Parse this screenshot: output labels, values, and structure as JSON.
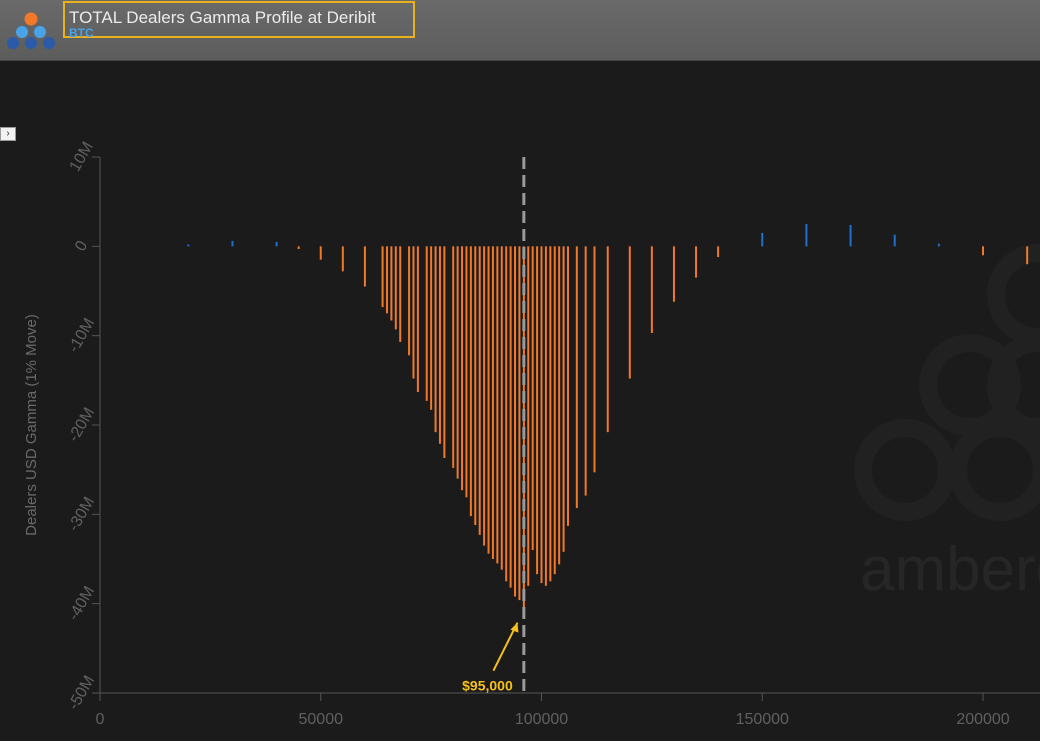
{
  "header": {
    "title": "TOTAL Dealers Gamma Profile at Deribit",
    "subtitle": "BTC",
    "logo_icon": "amberdata-logo-icon",
    "expand_icon": "chevron-right-icon"
  },
  "colors": {
    "negative": "#f2782a",
    "positive": "#1f6fd1",
    "annotation": "#f5c01c",
    "spot_line": "#9a9a9a"
  },
  "chart_data": {
    "type": "bar",
    "title": "TOTAL Dealers Gamma Profile at Deribit",
    "subtitle": "BTC",
    "xlabel": "",
    "ylabel": "Dealers USD Gamma (1% Move)",
    "xlim": [
      0,
      212000
    ],
    "ylim": [
      -50000000,
      10000000
    ],
    "x_ticks": [
      0,
      50000,
      100000,
      150000,
      200000
    ],
    "x_tick_labels": [
      "0",
      "50000",
      "100000",
      "150000",
      "200000"
    ],
    "y_ticks": [
      10000000,
      0,
      -10000000,
      -20000000,
      -30000000,
      -40000000,
      -50000000
    ],
    "y_tick_labels": [
      "10M",
      "0",
      "-10M",
      "-20M",
      "-30M",
      "-40M",
      "-50M"
    ],
    "spot_price": 96000,
    "annotation": {
      "text": "$95,000",
      "x": 95000,
      "y": -40000000
    },
    "grid": false,
    "watermark": "amberdata",
    "strikes": [
      20000,
      30000,
      40000,
      45000,
      50000,
      55000,
      60000,
      64000,
      65000,
      66000,
      67000,
      68000,
      70000,
      71000,
      72000,
      74000,
      75000,
      76000,
      77000,
      78000,
      80000,
      81000,
      82000,
      83000,
      84000,
      85000,
      86000,
      87000,
      88000,
      89000,
      90000,
      91000,
      92000,
      93000,
      94000,
      95000,
      96000,
      97000,
      98000,
      99000,
      100000,
      101000,
      102000,
      103000,
      104000,
      105000,
      106000,
      108000,
      110000,
      112000,
      115000,
      120000,
      125000,
      130000,
      135000,
      140000,
      150000,
      160000,
      170000,
      180000,
      190000,
      200000,
      210000
    ],
    "gamma": [
      200000,
      600000,
      500000,
      -300000,
      -1500000,
      -2800000,
      -4500000,
      -6800000,
      -7500000,
      -8300000,
      -9300000,
      -10700000,
      -12200000,
      -14800000,
      -16300000,
      -17300000,
      -18300000,
      -20800000,
      -22100000,
      -23700000,
      -24800000,
      -26000000,
      -27300000,
      -28100000,
      -30200000,
      -31200000,
      -32300000,
      -33500000,
      -34400000,
      -35000000,
      -35500000,
      -36200000,
      -37500000,
      -38200000,
      -39200000,
      -39600000,
      -40800000,
      -38000000,
      -34000000,
      -36700000,
      -37700000,
      -38000000,
      -37500000,
      -36700000,
      -35600000,
      -34200000,
      -31300000,
      -29300000,
      -27900000,
      -25300000,
      -20800000,
      -14800000,
      -9700000,
      -6200000,
      -3500000,
      -1200000,
      1500000,
      2500000,
      2400000,
      1300000,
      300000,
      -1000000,
      -2000000
    ]
  }
}
